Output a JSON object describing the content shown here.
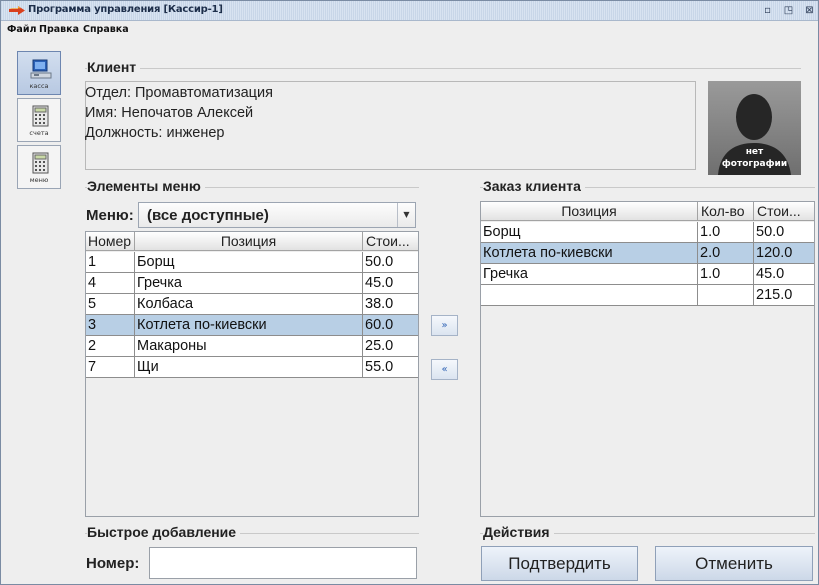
{
  "window": {
    "title": "Программа управления [Кассир-1]",
    "btn_restore": "▫",
    "btn_max": "◳",
    "btn_close": "⊠"
  },
  "menu": [
    "Файл",
    "Правка",
    "Справка"
  ],
  "toolbar": [
    {
      "label": "касса",
      "icon": "cash-register-icon",
      "active": true
    },
    {
      "label": "счета",
      "icon": "bills-icon",
      "active": false
    },
    {
      "label": "меню",
      "icon": "menu-list-icon",
      "active": false
    }
  ],
  "client": {
    "group_title": "Клиент",
    "department": "Отдел: Промавтоматизация",
    "name": "Имя: Непочатов Алексей",
    "position": "Должность: инженер",
    "photo_text_1": "нет",
    "photo_text_2": "фотографии"
  },
  "menu_items": {
    "group_title": "Элементы меню",
    "filter_label": "Меню:",
    "filter_value": "(все доступные)",
    "columns": [
      "Номер",
      "Позиция",
      "Стои..."
    ],
    "rows": [
      {
        "num": "1",
        "item": "Борщ",
        "price": "50.0",
        "selected": false
      },
      {
        "num": "4",
        "item": "Гречка",
        "price": "45.0",
        "selected": false
      },
      {
        "num": "5",
        "item": "Колбаса",
        "price": "38.0",
        "selected": false
      },
      {
        "num": "3",
        "item": "Котлета по-киевски",
        "price": "60.0",
        "selected": true
      },
      {
        "num": "2",
        "item": "Макароны",
        "price": "25.0",
        "selected": false
      },
      {
        "num": "7",
        "item": "Щи",
        "price": "55.0",
        "selected": false
      }
    ]
  },
  "transfer": {
    "add": "»",
    "remove": "«"
  },
  "order": {
    "group_title": "Заказ клиента",
    "columns": [
      "Позиция",
      "Кол-во",
      "Стои..."
    ],
    "rows": [
      {
        "item": "Борщ",
        "qty": "1.0",
        "price": "50.0",
        "selected": false
      },
      {
        "item": "Котлета по-киевски",
        "qty": "2.0",
        "price": "120.0",
        "selected": true
      },
      {
        "item": "Гречка",
        "qty": "1.0",
        "price": "45.0",
        "selected": false
      },
      {
        "item": "",
        "qty": "",
        "price": "215.0",
        "selected": false
      }
    ]
  },
  "quick_add": {
    "group_title": "Быстрое добавление",
    "label": "Номер:",
    "value": ""
  },
  "actions": {
    "group_title": "Действия",
    "confirm": "Подтвердить",
    "cancel": "Отменить"
  }
}
